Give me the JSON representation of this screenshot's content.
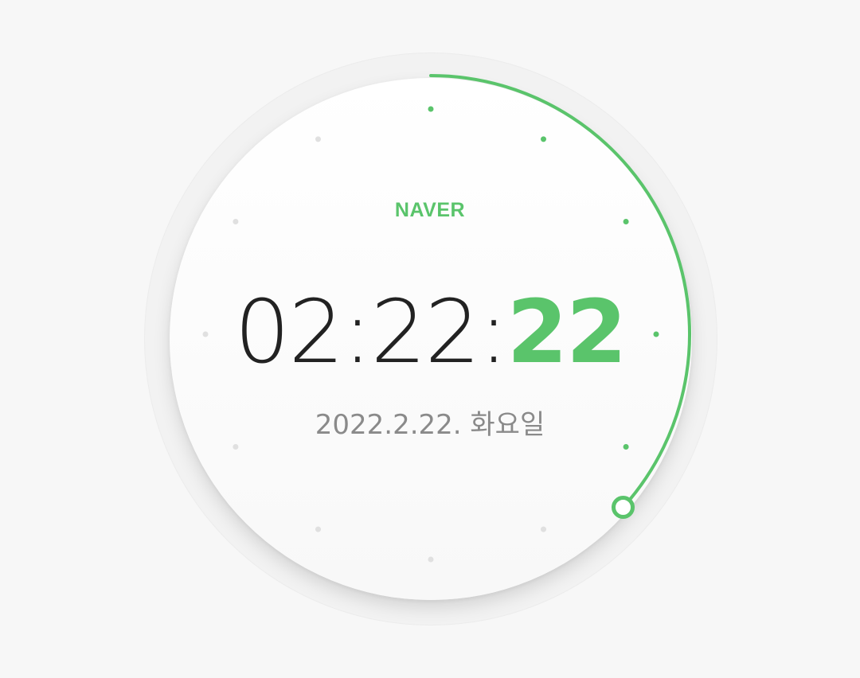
{
  "clock": {
    "brand": "NAVER",
    "hours": "02",
    "minutes": "22",
    "seconds": "22",
    "separator": ":",
    "date": "2022.2.22. 화요일",
    "seconds_progress": 0.3667,
    "colors": {
      "accent": "#5ac46b",
      "time_text": "#222222",
      "date_text": "#8a8a8a",
      "inactive_dot": "#e0e0e0",
      "background": "#f7f7f7"
    }
  }
}
